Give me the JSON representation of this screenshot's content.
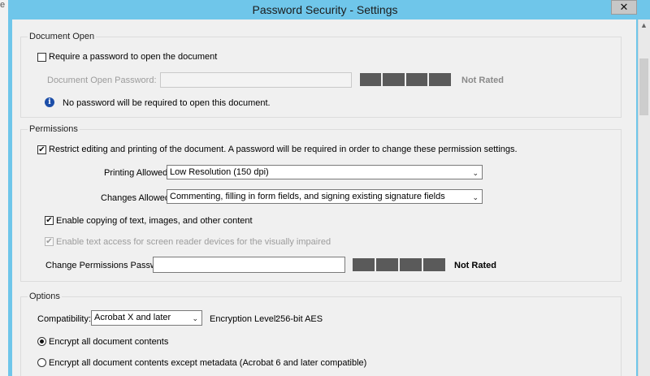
{
  "window": {
    "title": "Password Security - Settings",
    "close_glyph": "✕"
  },
  "background": {
    "glyph": "e"
  },
  "document_open": {
    "heading": "Document Open",
    "require_password_label": "Require a password to open the document",
    "require_password_checked": false,
    "password_label": "Document Open Password:",
    "password_value": "",
    "strength_label": "Not Rated",
    "info_text": "No password will be required to open this document.",
    "info_glyph": "i"
  },
  "permissions": {
    "heading": "Permissions",
    "restrict_label": "Restrict editing and printing of the document. A password will be required in order to change these permission settings.",
    "restrict_checked": true,
    "printing_label": "Printing Allowed:",
    "printing_value": "Low Resolution (150 dpi)",
    "changes_label": "Changes Allowed:",
    "changes_value": "Commenting, filling in form fields, and signing existing signature fields",
    "copy_label": "Enable copying of text, images, and other content",
    "copy_checked": true,
    "screen_reader_label": "Enable text access for screen reader devices for the visually impaired",
    "screen_reader_checked": true,
    "change_pw_label": "Change Permissions Password:",
    "change_pw_value": "",
    "strength_label": "Not Rated"
  },
  "options": {
    "heading": "Options",
    "compat_label": "Compatibility:",
    "compat_value": "Acrobat X and later",
    "encryption_label": "Encryption  Level:",
    "encryption_value": "256-bit AES",
    "radio_all_label": "Encrypt all document contents",
    "radio_all_selected": true,
    "radio_except_label": "Encrypt all document contents except metadata (Acrobat 6 and later compatible)",
    "radio_except_selected": false
  },
  "glyphs": {
    "check": "✔",
    "chevron": "⌄",
    "up": "▲",
    "down": "▼"
  },
  "colors": {
    "titlebar": "#6fc6ea",
    "meter": "#5a5a5a",
    "info": "#1c4ea8"
  }
}
